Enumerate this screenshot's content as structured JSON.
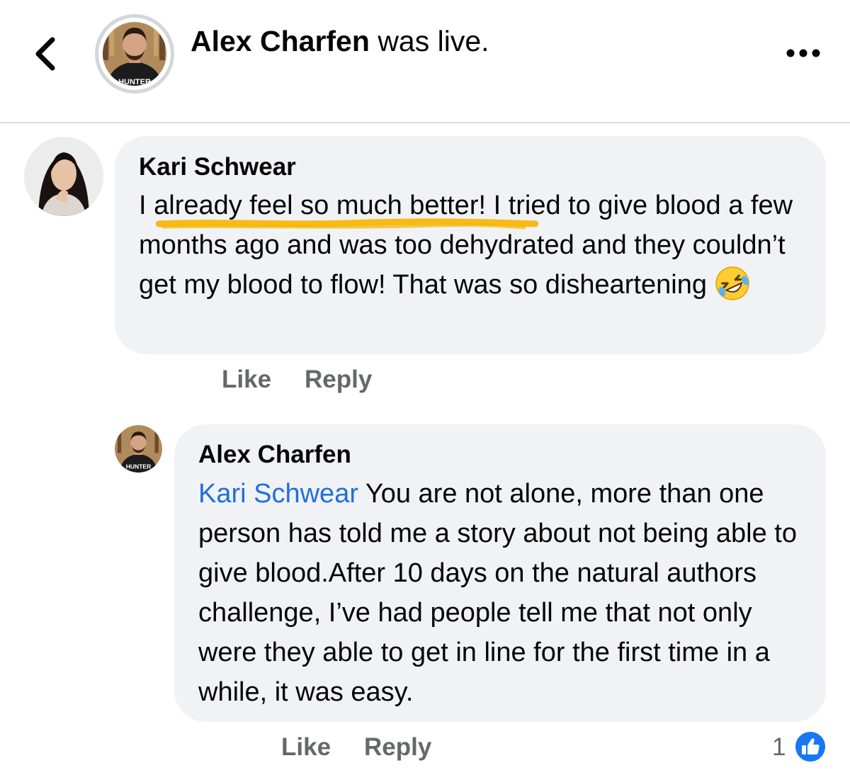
{
  "header": {
    "author_name": "Alex Charfen",
    "title_suffix": " was live.",
    "avatar_shirt_text": "HUNTER",
    "back_icon": "chevron-left-icon",
    "more_icon": "more-horizontal-icon"
  },
  "comments": [
    {
      "author": "Kari Schwear",
      "text": "I already feel so much better! I tried to give blood a few months ago and was too dehydrated and they couldn’t get my blood to flow! That was so disheartening",
      "emoji": "rolling-on-the-floor-laughing-emoji",
      "highlight_color": "#f7b500",
      "actions": {
        "like": "Like",
        "reply": "Reply"
      }
    },
    {
      "author": "Alex Charfen",
      "mention": "Kari Schwear",
      "text": " You are not alone, more than one person has told me a story about not being able to give blood.After 10 days on the natural authors challenge, I’ve had people tell me that not only were they able to get in line for the first time in a while, it was easy.",
      "actions": {
        "like": "Like",
        "reply": "Reply"
      },
      "reaction_count": "1",
      "reaction_icon": "thumbs-up-icon",
      "avatar_shirt_text": "HUNTER"
    }
  ],
  "colors": {
    "mention": "#216fdb",
    "bubble": "#f0f2f5",
    "action_text": "#65676b",
    "like_badge": "#1877f2"
  }
}
